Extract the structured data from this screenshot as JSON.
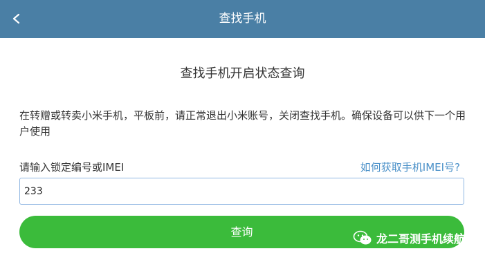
{
  "header": {
    "title": "查找手机",
    "back_icon": "chevron-left-icon"
  },
  "main": {
    "heading": "查找手机开启状态查询",
    "description": "在转赠或转卖小米手机，平板前，请正常退出小米账号，关闭查找手机。确保设备可以供下一个用户使用",
    "input_label": "请输入锁定编号或IMEI",
    "help_link": "如何获取手机IMEI号?",
    "input_value": "233",
    "query_button": "查询"
  },
  "watermark": {
    "icon": "wechat-icon",
    "text": "龙二哥测手机续航"
  },
  "colors": {
    "header_bg": "#4a7fa5",
    "link": "#4a90c8",
    "button_bg": "#3bbb3b",
    "input_border": "#8fb6e2"
  }
}
